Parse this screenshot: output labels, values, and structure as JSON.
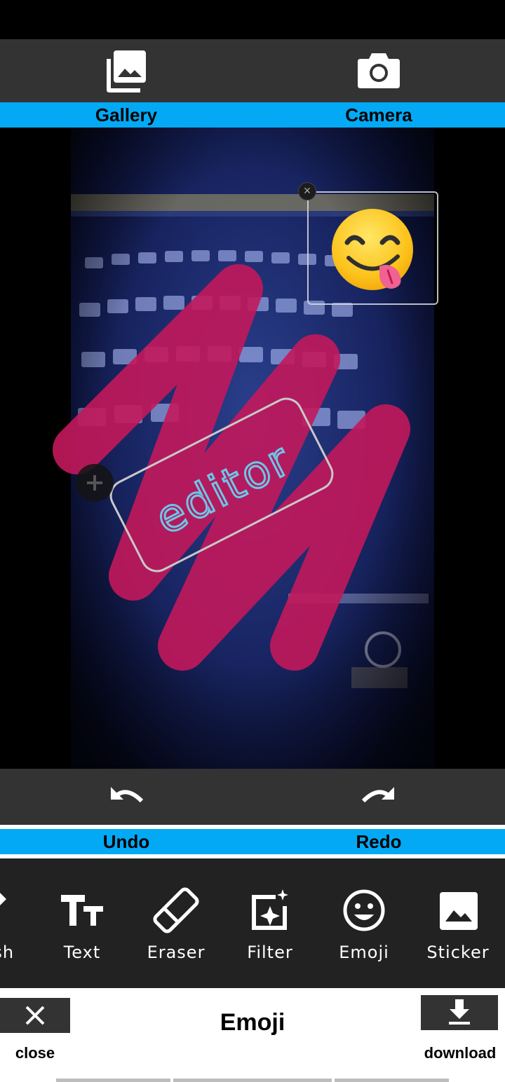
{
  "top_bar": {
    "gallery_label": "Gallery",
    "camera_label": "Camera",
    "gallery_icon": "photo-library-icon",
    "camera_icon": "camera-icon",
    "accent_color": "#03a9f4"
  },
  "canvas": {
    "text_sticker": "editor",
    "text_sticker_color": "#6ec6e8",
    "emoji_sticker": "😋",
    "brush_color": "#c2185b"
  },
  "history": {
    "undo_label": "Undo",
    "redo_label": "Redo"
  },
  "tools": [
    {
      "label": "Brush",
      "icon": "brush-icon"
    },
    {
      "label": "Text",
      "icon": "text-icon"
    },
    {
      "label": "Eraser",
      "icon": "eraser-icon"
    },
    {
      "label": "Filter",
      "icon": "filter-icon"
    },
    {
      "label": "Emoji",
      "icon": "emoji-icon"
    },
    {
      "label": "Sticker",
      "icon": "sticker-icon"
    }
  ],
  "bottom_bar": {
    "close_label": "close",
    "title": "Emoji",
    "download_label": "download"
  }
}
